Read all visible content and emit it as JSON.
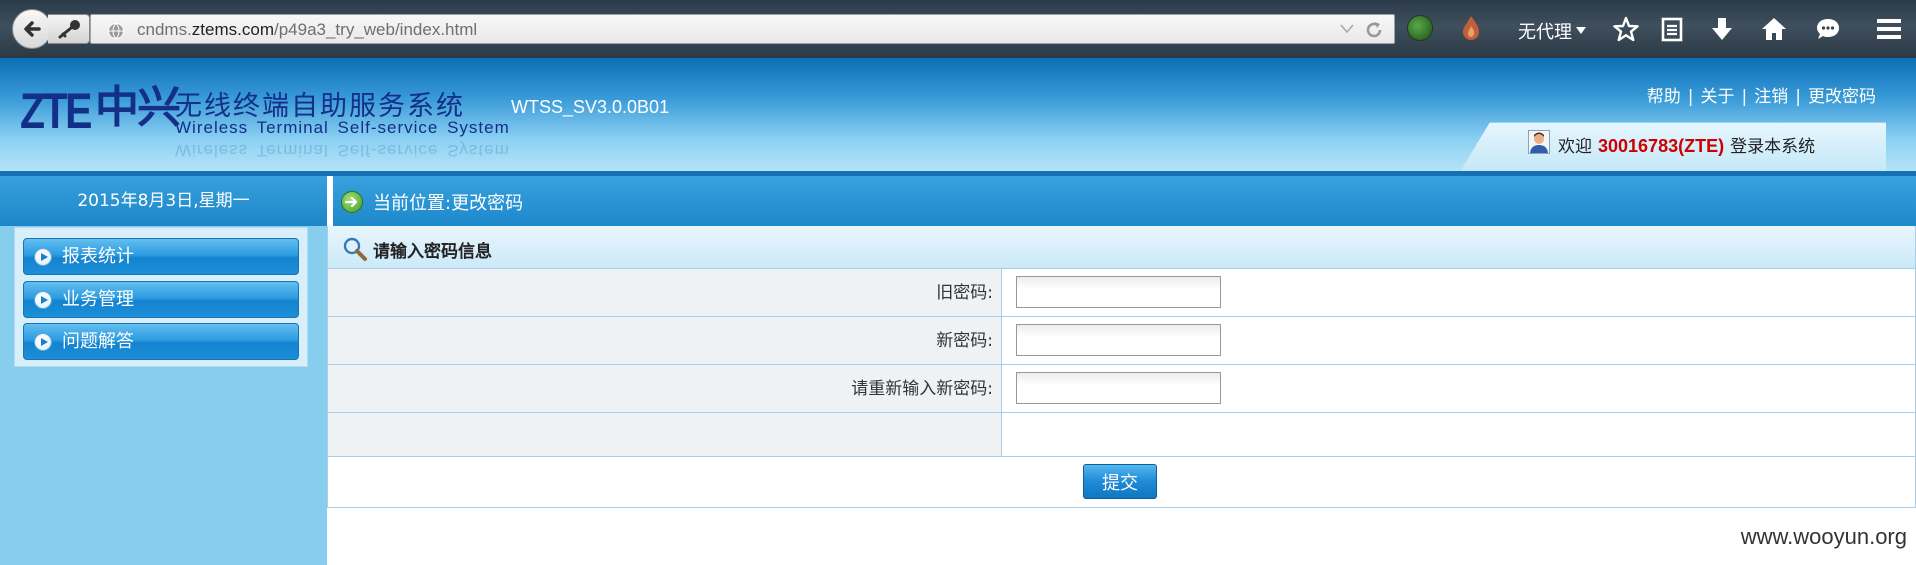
{
  "browser": {
    "url_prefix": "cndms.",
    "url_host": "ztems.com",
    "url_path": "/p49a3_try_web/index.html",
    "proxy_label": "无代理"
  },
  "header": {
    "logo_text": "ZTE",
    "logo_cn": "中兴",
    "system_title_cn": "无线终端自助服务系统",
    "system_title_en": "Wireless Terminal Self-service System",
    "version": "WTSS_SV3.0.0B01",
    "links": [
      "帮助",
      "关于",
      "注销",
      "更改密码"
    ],
    "link_separator": "|",
    "welcome_prefix": "欢迎",
    "welcome_user": "30016783(ZTE)",
    "welcome_suffix": "登录本系统"
  },
  "sidebar": {
    "date": "2015年8月3日,星期一",
    "items": [
      {
        "label": "报表统计"
      },
      {
        "label": "业务管理"
      },
      {
        "label": "问题解答"
      }
    ]
  },
  "main": {
    "breadcrumb": "当前位置:更改密码",
    "form_title": "请输入密码信息",
    "fields": [
      {
        "label": "旧密码:",
        "value": ""
      },
      {
        "label": "新密码:",
        "value": ""
      },
      {
        "label": "请重新输入新密码:",
        "value": ""
      }
    ],
    "submit_label": "提交"
  },
  "watermark": "www.wooyun.org",
  "colors": {
    "header_blue": "#1d88cb",
    "sidebar_bg": "#86cdee",
    "welcome_user": "#cc0000",
    "logo_navy": "#142f88"
  }
}
